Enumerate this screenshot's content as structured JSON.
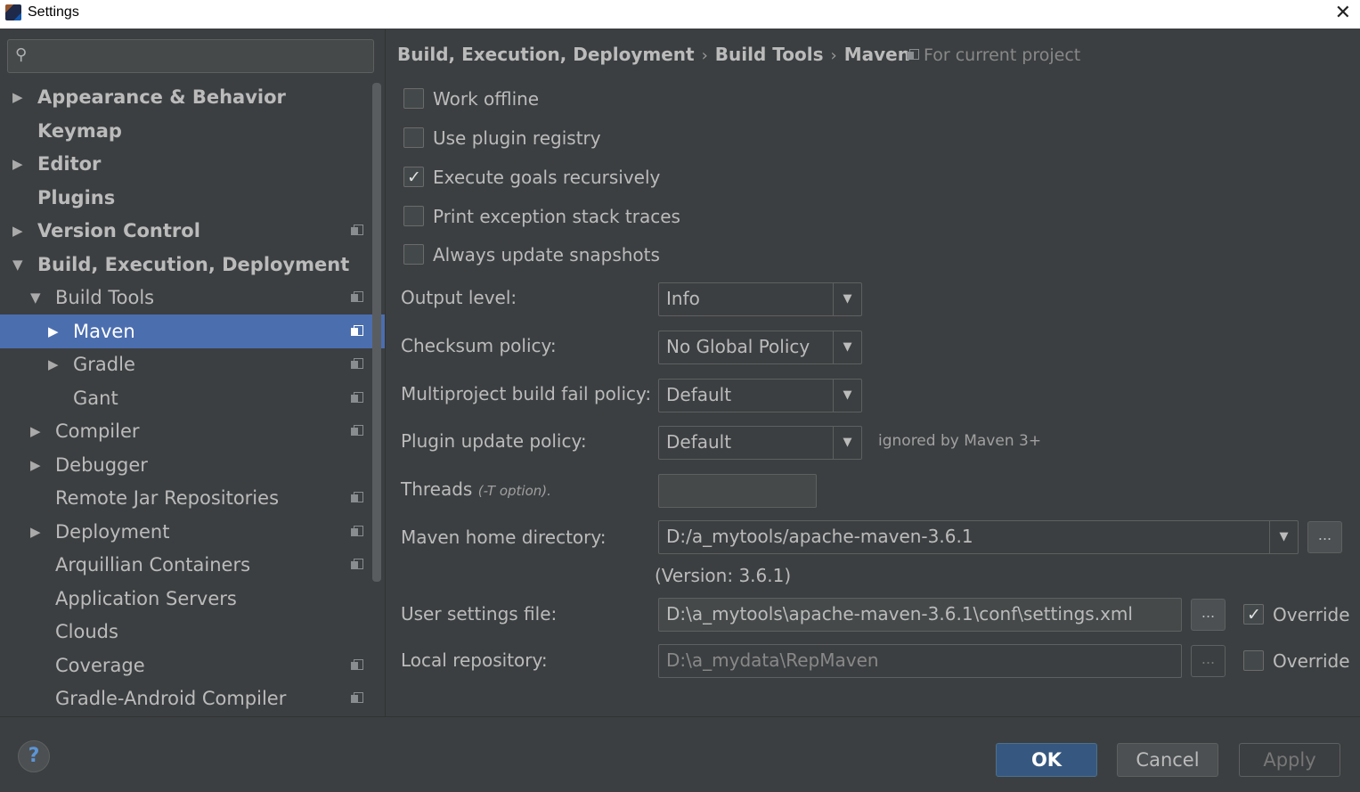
{
  "window": {
    "title": "Settings"
  },
  "search": {
    "placeholder": ""
  },
  "tree": [
    {
      "label": "Appearance & Behavior",
      "level": 0,
      "bold": true,
      "arrow": "right",
      "project": false,
      "selected": false
    },
    {
      "label": "Keymap",
      "level": 0,
      "bold": true,
      "arrow": "",
      "project": false,
      "selected": false
    },
    {
      "label": "Editor",
      "level": 0,
      "bold": true,
      "arrow": "right",
      "project": false,
      "selected": false
    },
    {
      "label": "Plugins",
      "level": 0,
      "bold": true,
      "arrow": "",
      "project": false,
      "selected": false
    },
    {
      "label": "Version Control",
      "level": 0,
      "bold": true,
      "arrow": "right",
      "project": true,
      "selected": false
    },
    {
      "label": "Build, Execution, Deployment",
      "level": 0,
      "bold": true,
      "arrow": "down",
      "project": false,
      "selected": false
    },
    {
      "label": "Build Tools",
      "level": 1,
      "bold": false,
      "arrow": "down",
      "project": true,
      "selected": false
    },
    {
      "label": "Maven",
      "level": 2,
      "bold": false,
      "arrow": "right",
      "project": true,
      "selected": true
    },
    {
      "label": "Gradle",
      "level": 2,
      "bold": false,
      "arrow": "right",
      "project": true,
      "selected": false
    },
    {
      "label": "Gant",
      "level": 2,
      "bold": false,
      "arrow": "",
      "project": true,
      "selected": false
    },
    {
      "label": "Compiler",
      "level": 1,
      "bold": false,
      "arrow": "right",
      "project": true,
      "selected": false
    },
    {
      "label": "Debugger",
      "level": 1,
      "bold": false,
      "arrow": "right",
      "project": false,
      "selected": false
    },
    {
      "label": "Remote Jar Repositories",
      "level": 1,
      "bold": false,
      "arrow": "",
      "project": true,
      "selected": false
    },
    {
      "label": "Deployment",
      "level": 1,
      "bold": false,
      "arrow": "right",
      "project": true,
      "selected": false
    },
    {
      "label": "Arquillian Containers",
      "level": 1,
      "bold": false,
      "arrow": "",
      "project": true,
      "selected": false
    },
    {
      "label": "Application Servers",
      "level": 1,
      "bold": false,
      "arrow": "",
      "project": false,
      "selected": false
    },
    {
      "label": "Clouds",
      "level": 1,
      "bold": false,
      "arrow": "",
      "project": false,
      "selected": false
    },
    {
      "label": "Coverage",
      "level": 1,
      "bold": false,
      "arrow": "",
      "project": true,
      "selected": false
    },
    {
      "label": "Gradle-Android Compiler",
      "level": 1,
      "bold": false,
      "arrow": "",
      "project": true,
      "selected": false
    }
  ],
  "breadcrumb": {
    "items": [
      "Build, Execution, Deployment",
      "Build Tools",
      "Maven"
    ],
    "separator": "›",
    "scope": "For current project"
  },
  "options": {
    "work_offline": {
      "label": "Work offline",
      "checked": false
    },
    "use_plugin_registry": {
      "label": "Use plugin registry",
      "checked": false
    },
    "execute_goals_recursively": {
      "label": "Execute goals recursively",
      "checked": true
    },
    "print_exception_stack_traces": {
      "label": "Print exception stack traces",
      "checked": false
    },
    "always_update_snapshots": {
      "label": "Always update snapshots",
      "checked": false
    }
  },
  "fields": {
    "output_level": {
      "label": "Output level:",
      "value": "Info"
    },
    "checksum_policy": {
      "label": "Checksum policy:",
      "value": "No Global Policy"
    },
    "multiproject_fail_policy": {
      "label": "Multiproject build fail policy:",
      "value": "Default"
    },
    "plugin_update_policy": {
      "label": "Plugin update policy:",
      "value": "Default",
      "hint": "ignored by Maven 3+"
    },
    "threads": {
      "label": "Threads",
      "hint": "(-T option).",
      "value": ""
    },
    "maven_home": {
      "label": "Maven home directory:",
      "value": "D:/a_mytools/apache-maven-3.6.1",
      "version": "(Version: 3.6.1)"
    },
    "user_settings": {
      "label": "User settings file:",
      "value": "D:\\a_mytools\\apache-maven-3.6.1\\conf\\settings.xml",
      "override_label": "Override",
      "override": true
    },
    "local_repository": {
      "label": "Local repository:",
      "value": "D:\\a_mydata\\RepMaven",
      "override_label": "Override",
      "override": false
    }
  },
  "browse_label": "...",
  "footer": {
    "help": "?",
    "ok": "OK",
    "cancel": "Cancel",
    "apply": "Apply"
  },
  "colors": {
    "background": "#3c3f41",
    "selection": "#4b6eaf",
    "primary_button": "#365880",
    "help_icon": "#5d95d6"
  }
}
